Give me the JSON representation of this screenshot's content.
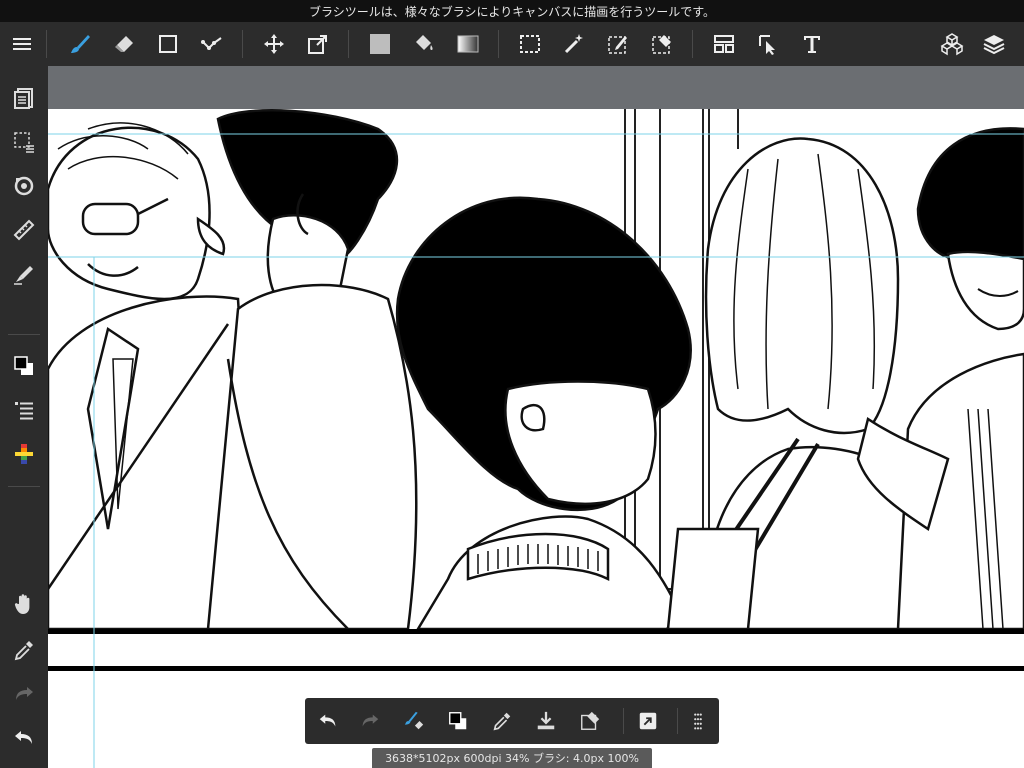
{
  "tooltip": {
    "text": "ブラシツールは、様々なブラシによりキャンバスに描画を行うツールです。"
  },
  "status": {
    "text": "3638*5102px 600dpi 34% ブラシ: 4.0px 100%"
  },
  "toolbar": {
    "tools": [
      "menu-icon",
      "brush-icon",
      "eraser-icon",
      "shape-icon",
      "polyline-icon",
      "move-icon",
      "transform-icon",
      "fill-color-icon",
      "bucket-icon",
      "gradient-icon",
      "select-rect-icon",
      "magic-wand-icon",
      "select-pen-icon",
      "select-eraser-icon",
      "frame-divide-icon",
      "operation-icon",
      "text-icon",
      "3d-icon",
      "layers-icon"
    ],
    "accent_color": "#3aa0e0"
  },
  "sidebar": {
    "tools": [
      "pages-icon",
      "selection-menu-icon",
      "rotate-icon",
      "ruler-icon",
      "pen-style-icon",
      "color-swap-icon",
      "brush-list-icon",
      "color-palette-icon",
      "hand-icon",
      "eyedropper-icon",
      "redo-icon",
      "undo-icon"
    ]
  },
  "bottom_bar": {
    "tools": [
      "undo-icon",
      "redo-icon",
      "brush-eraser-toggle-icon",
      "color-swap-icon",
      "eyedropper-icon",
      "import-icon",
      "eraser-selection-icon",
      "external-icon",
      "grid-menu-icon"
    ]
  }
}
